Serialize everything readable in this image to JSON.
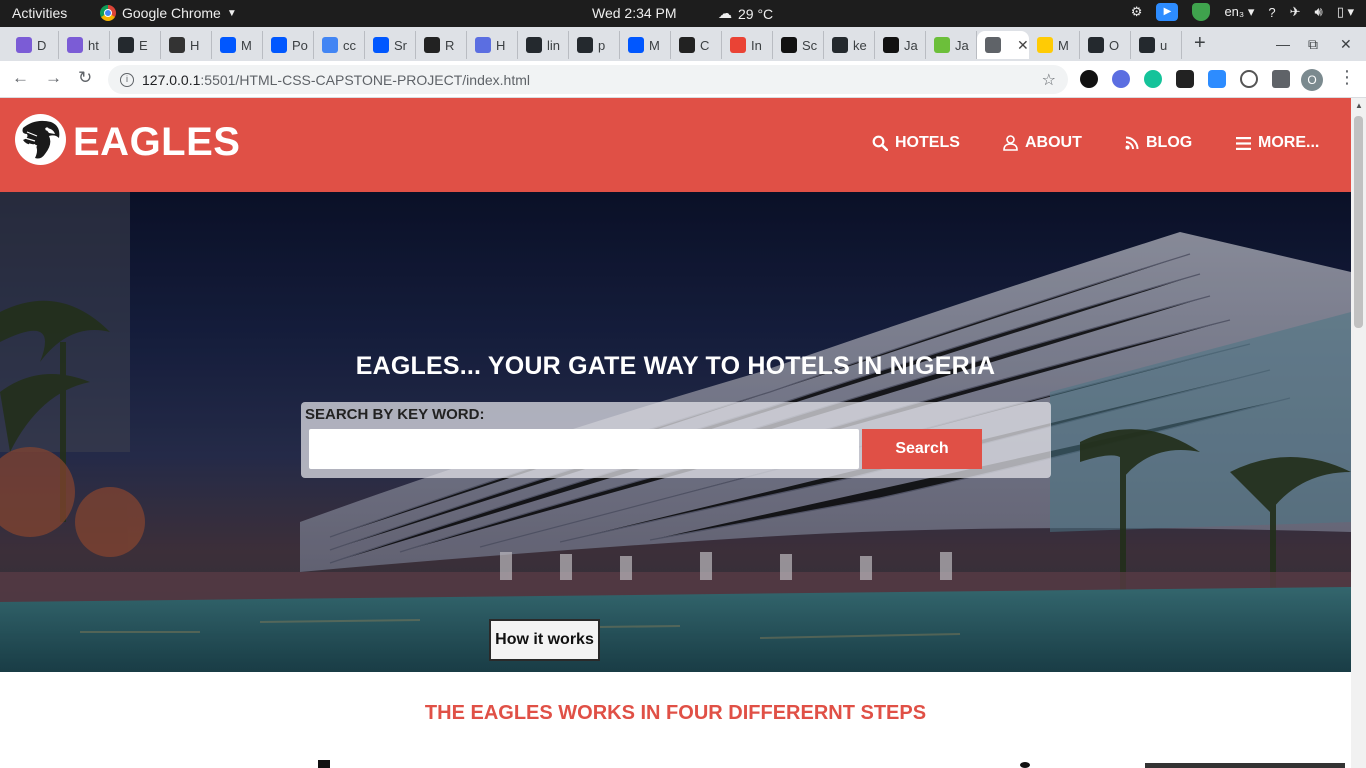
{
  "system_bar": {
    "activities": "Activities",
    "app_name": "Google Chrome",
    "clock": "Wed  2:34 PM",
    "weather": "29 °C",
    "input_method": "en₃"
  },
  "tabs": [
    {
      "label": "D",
      "favicon": "purple-m-icon",
      "color": "#7b5cd6"
    },
    {
      "label": "ht",
      "favicon": "purple-m-icon",
      "color": "#7b5cd6"
    },
    {
      "label": "E",
      "favicon": "github-icon",
      "color": "#24292e"
    },
    {
      "label": "H",
      "favicon": "graduation-cap-icon",
      "color": "#333333"
    },
    {
      "label": "M",
      "favicon": "behance-icon",
      "color": "#0057ff"
    },
    {
      "label": "Po",
      "favicon": "behance-icon",
      "color": "#0057ff"
    },
    {
      "label": "cc",
      "favicon": "google-icon",
      "color": "#4285f4"
    },
    {
      "label": "Sr",
      "favicon": "behance-icon",
      "color": "#0057ff"
    },
    {
      "label": "R",
      "favicon": "black-circle-icon",
      "color": "#222222"
    },
    {
      "label": "H",
      "favicon": "blue-gear-icon",
      "color": "#5b6ee1"
    },
    {
      "label": "lin",
      "favicon": "github-icon",
      "color": "#24292e"
    },
    {
      "label": "p",
      "favicon": "github-icon",
      "color": "#24292e"
    },
    {
      "label": "M",
      "favicon": "behance-icon",
      "color": "#0057ff"
    },
    {
      "label": "C",
      "favicon": "cc-icon",
      "color": "#222222"
    },
    {
      "label": "In",
      "favicon": "gmail-icon",
      "color": "#ea4335"
    },
    {
      "label": "Sc",
      "favicon": "hackerrank-icon",
      "color": "#111111"
    },
    {
      "label": "ke",
      "favicon": "github-icon",
      "color": "#24292e"
    },
    {
      "label": "Ja",
      "favicon": "codewars-icon",
      "color": "#111111"
    },
    {
      "label": "Ja",
      "favicon": "green-leaf-icon",
      "color": "#6cbf3a"
    },
    {
      "label": "",
      "favicon": "globe-icon",
      "color": "#5f6368",
      "active": true
    },
    {
      "label": "M",
      "favicon": "mtn-icon",
      "color": "#ffcb05"
    },
    {
      "label": "O",
      "favicon": "github-icon",
      "color": "#24292e"
    },
    {
      "label": "u",
      "favicon": "github-icon",
      "color": "#24292e"
    }
  ],
  "address_bar": {
    "url_host": "127.0.0.1",
    "url_path": ":5501/HTML-CSS-CAPSTONE-PROJECT/index.html",
    "profile_initial": "O"
  },
  "site": {
    "brand": "EAGLES",
    "nav": [
      {
        "label": "HOTELS",
        "icon": "search-icon"
      },
      {
        "label": "ABOUT",
        "icon": "user-icon"
      },
      {
        "label": "BLOG",
        "icon": "rss-icon"
      },
      {
        "label": "MORE...",
        "icon": "menu-icon"
      }
    ],
    "hero": {
      "title": "EAGLES... YOUR GATE WAY TO HOTELS IN NIGERIA",
      "search_label": "SEARCH BY KEY WORD:",
      "search_value": "",
      "search_button": "Search",
      "how_button": "How it works"
    },
    "steps_title": "THE EAGLES WORKS IN FOUR DIFFERERNT STEPS"
  },
  "colors": {
    "brand_red": "#e05046",
    "white": "#ffffff"
  }
}
